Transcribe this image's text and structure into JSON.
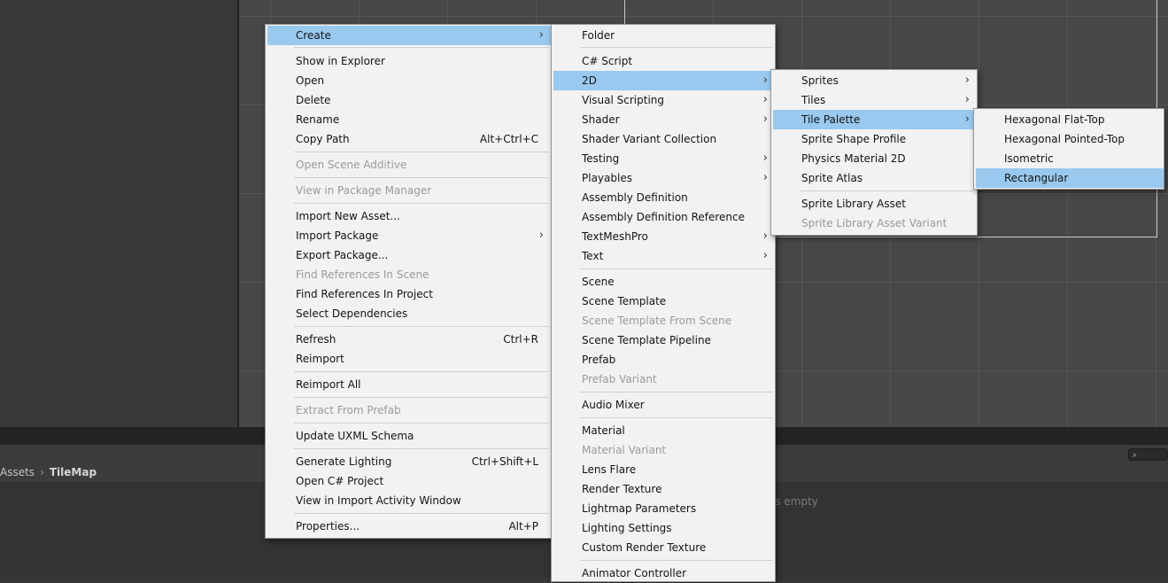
{
  "breadcrumb": {
    "root": "Assets",
    "current": "TileMap"
  },
  "project": {
    "empty_text": "is empty"
  },
  "search": {
    "icon": "search-icon",
    "glyph": "⌕"
  },
  "menus": {
    "main": [
      {
        "label": "Create",
        "submenu": true,
        "highlighted": true
      },
      {
        "label": "Show in Explorer"
      },
      {
        "label": "Open"
      },
      {
        "label": "Delete"
      },
      {
        "label": "Rename"
      },
      {
        "label": "Copy Path",
        "shortcut": "Alt+Ctrl+C"
      },
      {
        "label": "Open Scene Additive",
        "disabled": true
      },
      {
        "label": "View in Package Manager",
        "disabled": true
      },
      {
        "label": "Import New Asset..."
      },
      {
        "label": "Import Package",
        "submenu": true
      },
      {
        "label": "Export Package..."
      },
      {
        "label": "Find References In Scene",
        "disabled": true
      },
      {
        "label": "Find References In Project"
      },
      {
        "label": "Select Dependencies"
      },
      {
        "label": "Refresh",
        "shortcut": "Ctrl+R"
      },
      {
        "label": "Reimport"
      },
      {
        "label": "Reimport All"
      },
      {
        "label": "Extract From Prefab",
        "disabled": true
      },
      {
        "label": "Update UXML Schema"
      },
      {
        "label": "Generate Lighting",
        "shortcut": "Ctrl+Shift+L"
      },
      {
        "label": "Open C# Project"
      },
      {
        "label": "View in Import Activity Window"
      },
      {
        "label": "Properties...",
        "shortcut": "Alt+P"
      }
    ],
    "create": [
      {
        "label": "Folder"
      },
      {
        "label": "C# Script"
      },
      {
        "label": "2D",
        "submenu": true,
        "highlighted": true
      },
      {
        "label": "Visual Scripting",
        "submenu": true
      },
      {
        "label": "Shader",
        "submenu": true
      },
      {
        "label": "Shader Variant Collection"
      },
      {
        "label": "Testing",
        "submenu": true
      },
      {
        "label": "Playables",
        "submenu": true
      },
      {
        "label": "Assembly Definition"
      },
      {
        "label": "Assembly Definition Reference"
      },
      {
        "label": "TextMeshPro",
        "submenu": true
      },
      {
        "label": "Text",
        "submenu": true
      },
      {
        "label": "Scene"
      },
      {
        "label": "Scene Template"
      },
      {
        "label": "Scene Template From Scene",
        "disabled": true
      },
      {
        "label": "Scene Template Pipeline"
      },
      {
        "label": "Prefab"
      },
      {
        "label": "Prefab Variant",
        "disabled": true
      },
      {
        "label": "Audio Mixer"
      },
      {
        "label": "Material"
      },
      {
        "label": "Material Variant",
        "disabled": true
      },
      {
        "label": "Lens Flare"
      },
      {
        "label": "Render Texture"
      },
      {
        "label": "Lightmap Parameters"
      },
      {
        "label": "Lighting Settings"
      },
      {
        "label": "Custom Render Texture"
      },
      {
        "label": "Animator Controller"
      }
    ],
    "twod": [
      {
        "label": "Sprites",
        "submenu": true
      },
      {
        "label": "Tiles",
        "submenu": true
      },
      {
        "label": "Tile Palette",
        "submenu": true,
        "highlighted": true
      },
      {
        "label": "Sprite Shape Profile"
      },
      {
        "label": "Physics Material 2D"
      },
      {
        "label": "Sprite Atlas"
      },
      {
        "label": "Sprite Library Asset"
      },
      {
        "label": "Sprite Library Asset Variant",
        "disabled": true
      }
    ],
    "palette": [
      {
        "label": "Hexagonal Flat-Top"
      },
      {
        "label": "Hexagonal Pointed-Top"
      },
      {
        "label": "Isometric"
      },
      {
        "label": "Rectangular",
        "highlighted": true
      }
    ]
  }
}
